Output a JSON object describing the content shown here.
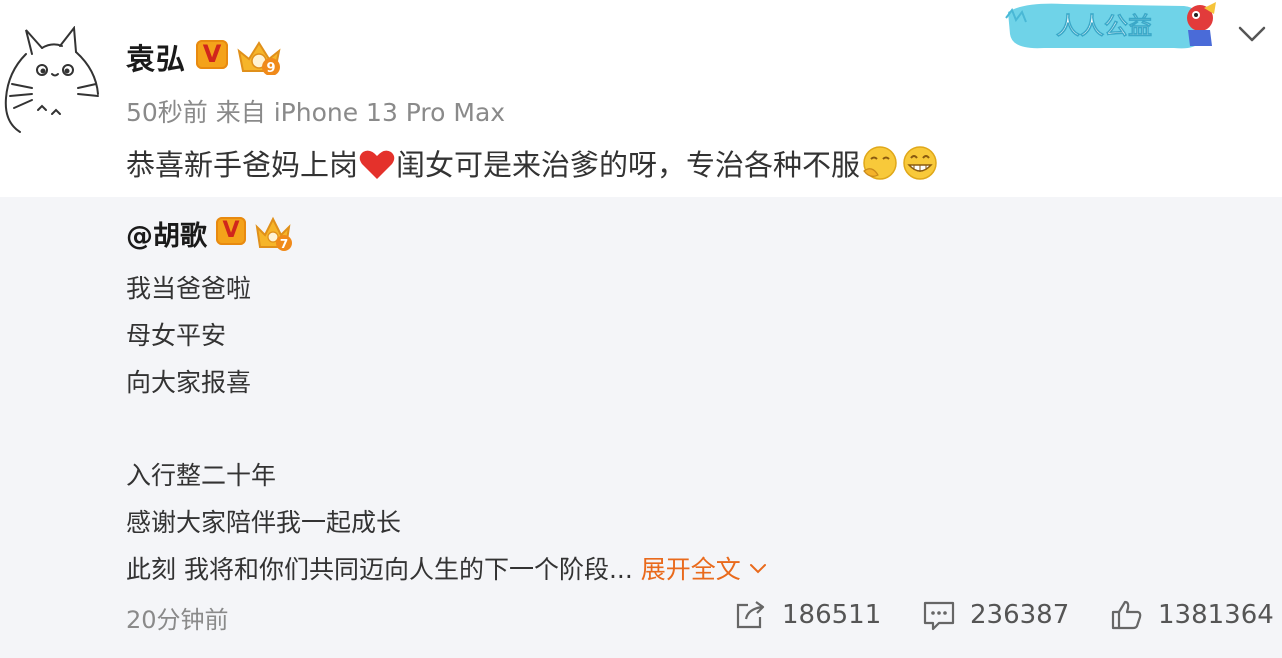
{
  "post": {
    "author": "袁弘",
    "verified_mark": "V",
    "meta": "50秒前 来自 iPhone 13 Pro Max",
    "text": "恭喜新手爸妈上岗",
    "text_after_heart": "闺女可是来治爹的呀，专治各种不服",
    "badge_level": "9",
    "welfare_label": "人人公益"
  },
  "repost": {
    "author": "@胡歌",
    "verified_mark": "V",
    "badge_level": "7",
    "lines": [
      "我当爸爸啦",
      "母女平安",
      "向大家报喜",
      "入行整二十年",
      "感谢大家陪伴我一起成长",
      "此刻 我将和你们共同迈向人生的下一个阶段..."
    ],
    "expand_label": "展开全文",
    "time": "20分钟前",
    "shares": "186511",
    "comments": "236387",
    "likes": "1381364"
  },
  "icons": {
    "avatar": "totoro-sketch",
    "menu": "chevron-down-icon",
    "share": "share-icon",
    "comment": "comment-icon",
    "like": "thumbs-up-icon"
  },
  "colors": {
    "accent": "#e96a1c",
    "badge_gold": "#f4a21a",
    "repost_bg": "#f4f5f8"
  }
}
